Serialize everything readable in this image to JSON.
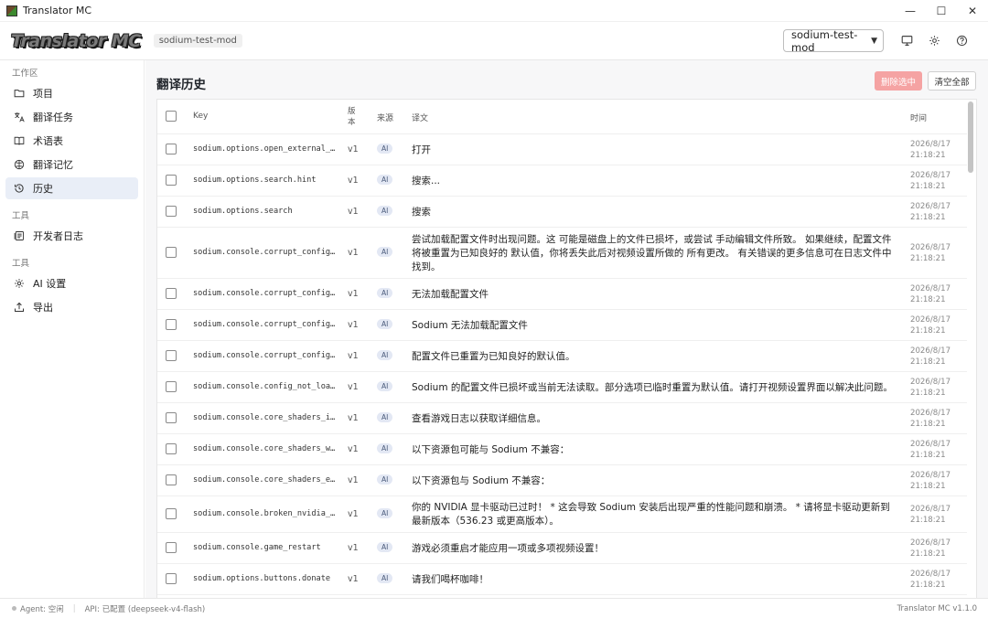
{
  "window": {
    "title": "Translator MC"
  },
  "header": {
    "logo_text": "Translator MC",
    "mod_tag": "sodium-test-mod",
    "mod_select_value": "sodium-test-mod"
  },
  "sidebar": {
    "sections": [
      {
        "title": "工作区",
        "items": [
          {
            "label": "项目",
            "icon": "folder-icon"
          },
          {
            "label": "翻译任务",
            "icon": "translate-icon"
          },
          {
            "label": "术语表",
            "icon": "book-icon"
          },
          {
            "label": "翻译记忆",
            "icon": "memory-icon"
          },
          {
            "label": "历史",
            "icon": "history-icon",
            "active": true
          }
        ]
      },
      {
        "title": "工具",
        "items": [
          {
            "label": "开发者日志",
            "icon": "log-icon"
          }
        ]
      },
      {
        "title": "工具",
        "items": [
          {
            "label": "AI 设置",
            "icon": "gear-icon"
          },
          {
            "label": "导出",
            "icon": "export-icon"
          }
        ]
      }
    ]
  },
  "main": {
    "title": "翻译历史",
    "delete_selected_label": "删除选中",
    "clear_all_label": "清空全部",
    "columns": {
      "key": "Key",
      "version": "版本",
      "source": "来源",
      "translation": "译文",
      "time": "时间"
    },
    "rows": [
      {
        "key": "sodium.options.open_external_…",
        "version": "v1",
        "source": "AI",
        "text": "打开",
        "date": "2026/8/17",
        "time": "21:18:21"
      },
      {
        "key": "sodium.options.search.hint",
        "version": "v1",
        "source": "AI",
        "text": "搜索...",
        "date": "2026/8/17",
        "time": "21:18:21"
      },
      {
        "key": "sodium.options.search",
        "version": "v1",
        "source": "AI",
        "text": "搜索",
        "date": "2026/8/17",
        "time": "21:18:21"
      },
      {
        "key": "sodium.console.corrupt_config…",
        "version": "v1",
        "source": "AI",
        "text": "尝试加载配置文件时出现问题。这 可能是磁盘上的文件已损坏，或尝试 手动编辑文件所致。 如果继续，配置文件将被重置为已知良好的 默认值，你将丢失此后对视频设置所做的 所有更改。 有关错误的更多信息可在日志文件中找到。",
        "date": "2026/8/17",
        "time": "21:18:21",
        "lines": 3
      },
      {
        "key": "sodium.console.corrupt_config…",
        "version": "v1",
        "source": "AI",
        "text": "无法加载配置文件",
        "date": "2026/8/17",
        "time": "21:18:21"
      },
      {
        "key": "sodium.console.corrupt_config…",
        "version": "v1",
        "source": "AI",
        "text": "Sodium 无法加载配置文件",
        "date": "2026/8/17",
        "time": "21:18:21"
      },
      {
        "key": "sodium.console.corrupt_config…",
        "version": "v1",
        "source": "AI",
        "text": "配置文件已重置为已知良好的默认值。",
        "date": "2026/8/17",
        "time": "21:18:21"
      },
      {
        "key": "sodium.console.config_not_loa…",
        "version": "v1",
        "source": "AI",
        "text": "Sodium 的配置文件已损坏或当前无法读取。部分选项已临时重置为默认值。请打开视频设置界面以解决此问题。",
        "date": "2026/8/17",
        "time": "21:18:21"
      },
      {
        "key": "sodium.console.core_shaders_i…",
        "version": "v1",
        "source": "AI",
        "text": "查看游戏日志以获取详细信息。",
        "date": "2026/8/17",
        "time": "21:18:21"
      },
      {
        "key": "sodium.console.core_shaders_w…",
        "version": "v1",
        "source": "AI",
        "text": "以下资源包可能与 Sodium 不兼容：",
        "date": "2026/8/17",
        "time": "21:18:21"
      },
      {
        "key": "sodium.console.core_shaders_e…",
        "version": "v1",
        "source": "AI",
        "text": "以下资源包与 Sodium 不兼容：",
        "date": "2026/8/17",
        "time": "21:18:21"
      },
      {
        "key": "sodium.console.broken_nvidia_…",
        "version": "v1",
        "source": "AI",
        "text": "你的 NVIDIA 显卡驱动已过时！ * 这会导致 Sodium 安装后出现严重的性能问题和崩溃。 * 请将显卡驱动更新到最新版本（536.23 或更高版本）。",
        "date": "2026/8/17",
        "time": "21:18:21",
        "lines": 2
      },
      {
        "key": "sodium.console.game_restart",
        "version": "v1",
        "source": "AI",
        "text": "游戏必须重启才能应用一项或多项视频设置！",
        "date": "2026/8/17",
        "time": "21:18:21"
      },
      {
        "key": "sodium.options.buttons.donate",
        "version": "v1",
        "source": "AI",
        "text": "请我们喝杯咖啡！",
        "date": "2026/8/17",
        "time": "21:18:21"
      }
    ]
  },
  "status": {
    "agent": "Agent: 空闲",
    "api": "API: 已配置 (deepseek-v4-flash)",
    "version": "Translator MC v1.1.0"
  }
}
